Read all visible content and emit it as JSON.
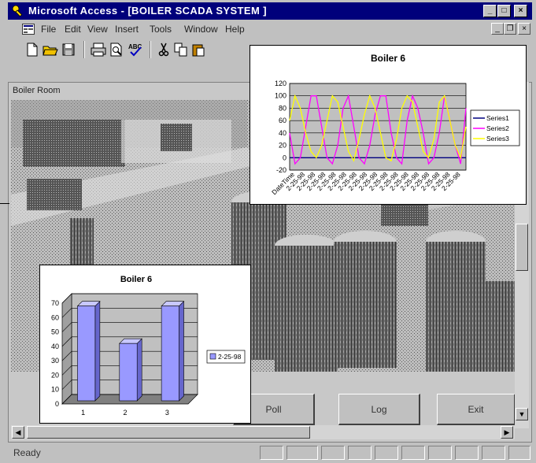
{
  "window": {
    "title": "Microsoft Access - [BOILER SCADA SYSTEM ]",
    "caption_minimize": "_",
    "caption_maximize": "□",
    "caption_close": "×"
  },
  "menu": {
    "items": [
      "File",
      "Edit",
      "View",
      "Insert",
      "Tools",
      "Window",
      "Help"
    ],
    "mdi_minimize": "_",
    "mdi_restore": "❐",
    "mdi_close": "×"
  },
  "toolbar": {
    "icons": [
      "new-icon",
      "open-icon",
      "save-icon",
      "print-icon",
      "print-preview-icon",
      "spelling-icon",
      "cut-icon",
      "copy-icon",
      "paste-icon"
    ]
  },
  "form": {
    "title": "Boiler Room",
    "buttons": {
      "poll": "Poll",
      "log": "Log",
      "exit": "Exit"
    }
  },
  "status": {
    "text": "Ready"
  },
  "chart_data": [
    {
      "type": "line",
      "title": "Boiler 6",
      "xlabel": "",
      "ylabel": "",
      "x_tick_labels": [
        "DateTime",
        "2-25-98",
        "2-25-98",
        "2-25-98",
        "2-25-98",
        "2-25-98",
        "2-25-98",
        "2-25-98",
        "2-25-98",
        "2-25-98",
        "2-25-98",
        "2-25-98",
        "2-25-98",
        "2-25-98",
        "2-25-98",
        "2-25-98",
        "2-25-98"
      ],
      "ylim": [
        -20,
        120
      ],
      "yticks": [
        -20,
        0,
        20,
        40,
        60,
        80,
        100,
        120
      ],
      "legend_position": "right",
      "grid": true,
      "series": [
        {
          "name": "Series1",
          "color": "#000080",
          "values": [
            0,
            0,
            0,
            0,
            0,
            0,
            0,
            0,
            0,
            0,
            0,
            0,
            0,
            0,
            0,
            0,
            0,
            0,
            0,
            0,
            0,
            0,
            0,
            0,
            0,
            0,
            0,
            0,
            0,
            0,
            0,
            0,
            0,
            0
          ]
        },
        {
          "name": "Series2",
          "color": "#ff00ff",
          "values": [
            40,
            -10,
            0,
            50,
            100,
            100,
            50,
            0,
            -10,
            20,
            80,
            100,
            50,
            0,
            -10,
            20,
            70,
            100,
            100,
            40,
            0,
            -10,
            60,
            100,
            80,
            40,
            -10,
            0,
            40,
            100,
            60,
            20,
            -10,
            80
          ]
        },
        {
          "name": "Series3",
          "color": "#ffff00",
          "values": [
            60,
            100,
            80,
            40,
            10,
            0,
            20,
            60,
            100,
            90,
            50,
            10,
            -5,
            30,
            70,
            100,
            80,
            40,
            0,
            -5,
            30,
            80,
            100,
            90,
            50,
            10,
            0,
            30,
            90,
            100,
            60,
            20,
            0,
            50
          ]
        }
      ]
    },
    {
      "type": "bar",
      "title": "Boiler 6",
      "categories": [
        "1",
        "2",
        "3"
      ],
      "ylim": [
        0,
        70
      ],
      "yticks": [
        0,
        10,
        20,
        30,
        40,
        50,
        60,
        70
      ],
      "legend_position": "right",
      "grid": true,
      "series": [
        {
          "name": "2-25-98",
          "color": "#9999ff",
          "values": [
            68,
            42,
            68
          ]
        }
      ]
    }
  ]
}
